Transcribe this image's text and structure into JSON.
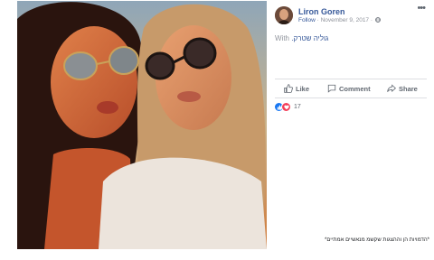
{
  "post": {
    "author": "Liron Goren",
    "follow_label": "Follow",
    "date": " · November 9, 2017 · ",
    "more_label": "•••",
    "with_prefix": "With ",
    "tagged": ".גוליה שטרק"
  },
  "actions": {
    "like": "Like",
    "comment": "Comment",
    "share": "Share"
  },
  "reactions": {
    "count": "17"
  },
  "caption": "*הדמויות הן וההצגות שקשמ מנאשיים אמתיים*",
  "colors": {
    "link": "#365899",
    "like_blue": "#1877f2",
    "love_red": "#f33e58"
  }
}
